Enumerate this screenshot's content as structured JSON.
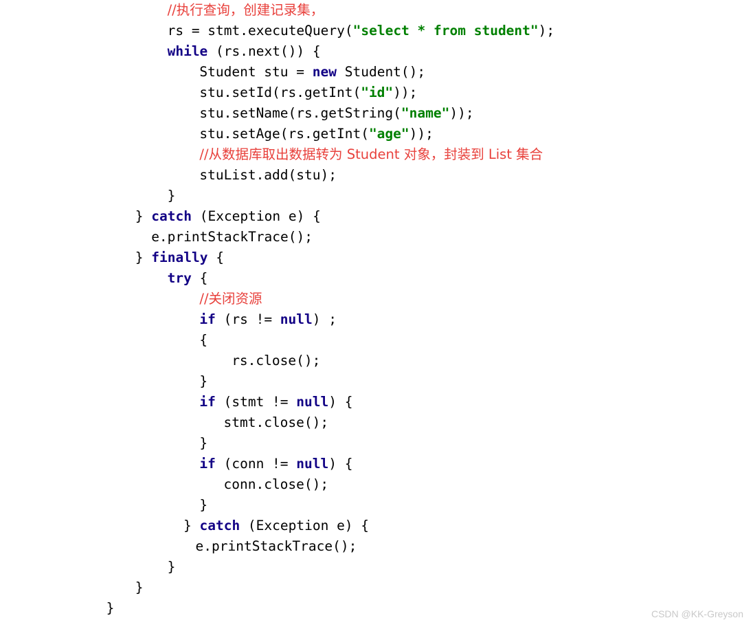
{
  "document": {
    "language": "java",
    "background_color": "#ffffff",
    "colors": {
      "plain": "#000000",
      "keyword": "#120085",
      "string": "#008000",
      "comment": "#e8413c",
      "watermark": "#c9c9c9"
    },
    "watermark": "CSDN @KK-Greyson"
  },
  "code": {
    "lines": [
      {
        "indent": 8,
        "tokens": [
          {
            "t": "comment-cn",
            "s": "//执行查询，创建记录集，"
          }
        ]
      },
      {
        "indent": 8,
        "tokens": [
          {
            "t": "plain",
            "s": "rs = stmt.executeQuery("
          },
          {
            "t": "string",
            "s": "\"select * from student\""
          },
          {
            "t": "plain",
            "s": ");"
          }
        ]
      },
      {
        "indent": 8,
        "tokens": [
          {
            "t": "keyword",
            "s": "while"
          },
          {
            "t": "plain",
            "s": " (rs.next()) {"
          }
        ]
      },
      {
        "indent": 12,
        "tokens": [
          {
            "t": "plain",
            "s": "Student stu = "
          },
          {
            "t": "keyword",
            "s": "new"
          },
          {
            "t": "plain",
            "s": " Student();"
          }
        ]
      },
      {
        "indent": 12,
        "tokens": [
          {
            "t": "plain",
            "s": "stu.setId(rs.getInt("
          },
          {
            "t": "string",
            "s": "\"id\""
          },
          {
            "t": "plain",
            "s": "));"
          }
        ]
      },
      {
        "indent": 12,
        "tokens": [
          {
            "t": "plain",
            "s": "stu.setName(rs.getString("
          },
          {
            "t": "string",
            "s": "\"name\""
          },
          {
            "t": "plain",
            "s": "));"
          }
        ]
      },
      {
        "indent": 12,
        "tokens": [
          {
            "t": "plain",
            "s": "stu.setAge(rs.getInt("
          },
          {
            "t": "string",
            "s": "\"age\""
          },
          {
            "t": "plain",
            "s": "));"
          }
        ]
      },
      {
        "indent": 12,
        "tokens": [
          {
            "t": "comment-cn",
            "s": "//从数据库取出数据转为 Student 对象，封装到 List 集合"
          }
        ]
      },
      {
        "indent": 12,
        "tokens": [
          {
            "t": "plain",
            "s": "stuList.add(stu);"
          }
        ]
      },
      {
        "indent": 8,
        "tokens": [
          {
            "t": "plain",
            "s": "}"
          }
        ]
      },
      {
        "indent": 4,
        "tokens": [
          {
            "t": "plain",
            "s": "} "
          },
          {
            "t": "keyword",
            "s": "catch"
          },
          {
            "t": "plain",
            "s": " (Exception e) {"
          }
        ]
      },
      {
        "indent": 6,
        "tokens": [
          {
            "t": "plain",
            "s": "e.printStackTrace();"
          }
        ]
      },
      {
        "indent": 4,
        "tokens": [
          {
            "t": "plain",
            "s": "} "
          },
          {
            "t": "keyword",
            "s": "finally"
          },
          {
            "t": "plain",
            "s": " {"
          }
        ]
      },
      {
        "indent": 8,
        "tokens": [
          {
            "t": "keyword",
            "s": "try"
          },
          {
            "t": "plain",
            "s": " {"
          }
        ]
      },
      {
        "indent": 12,
        "tokens": [
          {
            "t": "comment-cn",
            "s": "//关闭资源"
          }
        ]
      },
      {
        "indent": 12,
        "tokens": [
          {
            "t": "keyword",
            "s": "if"
          },
          {
            "t": "plain",
            "s": " (rs != "
          },
          {
            "t": "keyword",
            "s": "null"
          },
          {
            "t": "plain",
            "s": ") ;"
          }
        ]
      },
      {
        "indent": 12,
        "tokens": [
          {
            "t": "plain",
            "s": "{"
          }
        ]
      },
      {
        "indent": 16,
        "tokens": [
          {
            "t": "plain",
            "s": "rs.close();"
          }
        ]
      },
      {
        "indent": 12,
        "tokens": [
          {
            "t": "plain",
            "s": "}"
          }
        ]
      },
      {
        "indent": 12,
        "tokens": [
          {
            "t": "keyword",
            "s": "if"
          },
          {
            "t": "plain",
            "s": " (stmt != "
          },
          {
            "t": "keyword",
            "s": "null"
          },
          {
            "t": "plain",
            "s": ") {"
          }
        ]
      },
      {
        "indent": 15,
        "tokens": [
          {
            "t": "plain",
            "s": "stmt.close();"
          }
        ]
      },
      {
        "indent": 12,
        "tokens": [
          {
            "t": "plain",
            "s": "}"
          }
        ]
      },
      {
        "indent": 12,
        "tokens": [
          {
            "t": "keyword",
            "s": "if"
          },
          {
            "t": "plain",
            "s": " (conn != "
          },
          {
            "t": "keyword",
            "s": "null"
          },
          {
            "t": "plain",
            "s": ") {"
          }
        ]
      },
      {
        "indent": 15,
        "tokens": [
          {
            "t": "plain",
            "s": "conn.close();"
          }
        ]
      },
      {
        "indent": 12,
        "tokens": [
          {
            "t": "plain",
            "s": "}"
          }
        ]
      },
      {
        "indent": 10,
        "tokens": [
          {
            "t": "plain",
            "s": "} "
          },
          {
            "t": "keyword",
            "s": "catch"
          },
          {
            "t": "plain",
            "s": " (Exception e) {"
          }
        ]
      },
      {
        "indent": 11.5,
        "tokens": [
          {
            "t": "plain",
            "s": "e.printStackTrace();"
          }
        ]
      },
      {
        "indent": 8,
        "tokens": [
          {
            "t": "plain",
            "s": "}"
          }
        ]
      },
      {
        "indent": 4,
        "tokens": [
          {
            "t": "plain",
            "s": "}"
          }
        ]
      },
      {
        "indent": 0.4,
        "tokens": [
          {
            "t": "plain",
            "s": "}"
          }
        ]
      }
    ]
  }
}
